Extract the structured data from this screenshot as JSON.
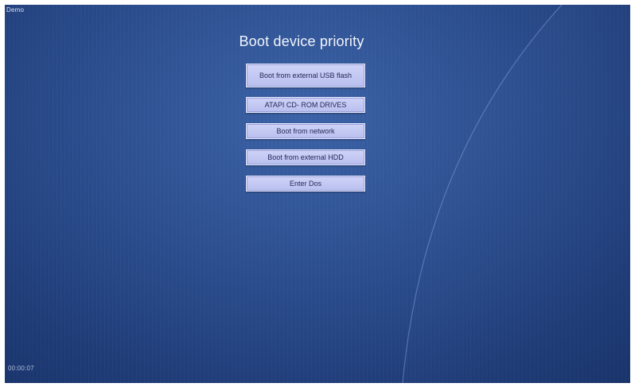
{
  "window": {
    "title": "Demo"
  },
  "screen": {
    "title": "Boot device priority",
    "footer_text": "00:00:07"
  },
  "boot_options": [
    {
      "label": "Boot from external USB flash"
    },
    {
      "label": "ATAPI CD- ROM DRIVES"
    },
    {
      "label": "Boot from network"
    },
    {
      "label": "Boot from external HDD"
    },
    {
      "label": "Enter Dos"
    }
  ],
  "colors": {
    "background": "#2c4f90",
    "button_fill": "#c5cbf4",
    "button_text": "#232859",
    "title_text": "#f2f5fb"
  }
}
